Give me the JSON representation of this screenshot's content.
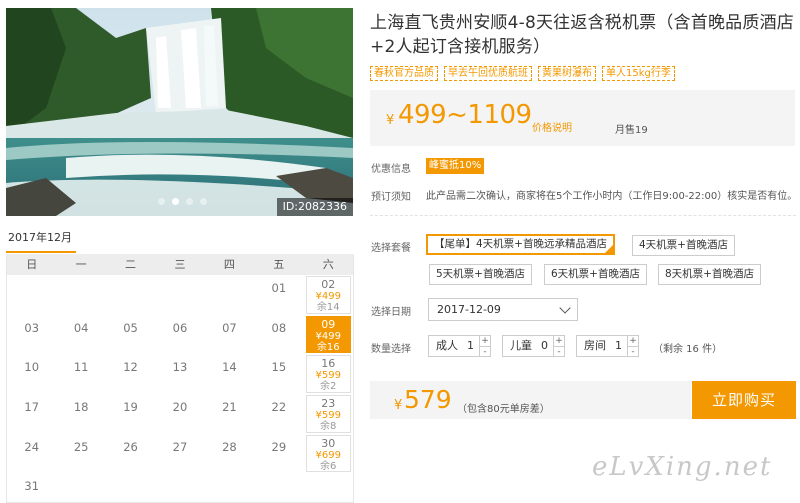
{
  "photo": {
    "id_label": "ID:2082336",
    "slide_count": 4,
    "active_slide": 1
  },
  "calendar": {
    "month_label": "2017年12月",
    "weekdays": [
      "日",
      "一",
      "二",
      "三",
      "四",
      "五",
      "六"
    ],
    "weeks": [
      [
        null,
        null,
        null,
        null,
        null,
        {
          "day": "01"
        },
        {
          "day": "02",
          "price": "¥499",
          "remain": "余14",
          "available": true
        }
      ],
      [
        {
          "day": "03"
        },
        {
          "day": "04"
        },
        {
          "day": "05"
        },
        {
          "day": "06"
        },
        {
          "day": "07"
        },
        {
          "day": "08"
        },
        {
          "day": "09",
          "price": "¥499",
          "remain": "余16",
          "available": true,
          "selected": true
        }
      ],
      [
        {
          "day": "10"
        },
        {
          "day": "11"
        },
        {
          "day": "12"
        },
        {
          "day": "13"
        },
        {
          "day": "14"
        },
        {
          "day": "15"
        },
        {
          "day": "16",
          "price": "¥599",
          "remain": "余2",
          "available": true
        }
      ],
      [
        {
          "day": "17"
        },
        {
          "day": "18"
        },
        {
          "day": "19"
        },
        {
          "day": "20"
        },
        {
          "day": "21"
        },
        {
          "day": "22"
        },
        {
          "day": "23",
          "price": "¥599",
          "remain": "余8",
          "available": true
        }
      ],
      [
        {
          "day": "24"
        },
        {
          "day": "25"
        },
        {
          "day": "26"
        },
        {
          "day": "27"
        },
        {
          "day": "28"
        },
        {
          "day": "29"
        },
        {
          "day": "30",
          "price": "¥699",
          "remain": "余6",
          "available": true
        }
      ],
      [
        {
          "day": "31"
        },
        null,
        null,
        null,
        null,
        null,
        null
      ]
    ]
  },
  "product": {
    "title": "上海直飞贵州安顺4-8天往返含税机票（含首晚品质酒店+2人起订含接机服务）",
    "tags": [
      "春秋官方品质",
      "早去午回优质航班",
      "黄果树瀑布",
      "单人15kg行李"
    ]
  },
  "price": {
    "currency": "¥",
    "range": "499~1109",
    "note": "价格说明",
    "monthly_sales": "月售19"
  },
  "promo": {
    "label": "优惠信息",
    "badge": "峰蜜抵10%"
  },
  "booking_notice": {
    "label": "预订须知",
    "text": "此产品需二次确认，商家将在5个工作小时内（工作日9:00-22:00）核实是否有位。"
  },
  "packages": {
    "label": "选择套餐",
    "items": [
      "【尾单】4天机票+首晚远承精品酒店",
      "4天机票+首晚酒店",
      "5天机票+首晚酒店",
      "6天机票+首晚酒店",
      "8天机票+首晚酒店"
    ],
    "selected_index": 0
  },
  "date_select": {
    "label": "选择日期",
    "value": "2017-12-09"
  },
  "quantity": {
    "label": "数量选择",
    "adult": {
      "label": "成人",
      "value": "1"
    },
    "child": {
      "label": "儿童",
      "value": "0"
    },
    "room": {
      "label": "房间",
      "value": "1"
    },
    "remaining": "（剩余 16 件）",
    "plus": "+",
    "minus": "-"
  },
  "checkout": {
    "currency": "¥",
    "total": "579",
    "note": "（包含80元单房差）",
    "buy_label": "立即购买"
  },
  "watermark": "eLvXing.net",
  "colors": {
    "accent": "#f39800"
  }
}
